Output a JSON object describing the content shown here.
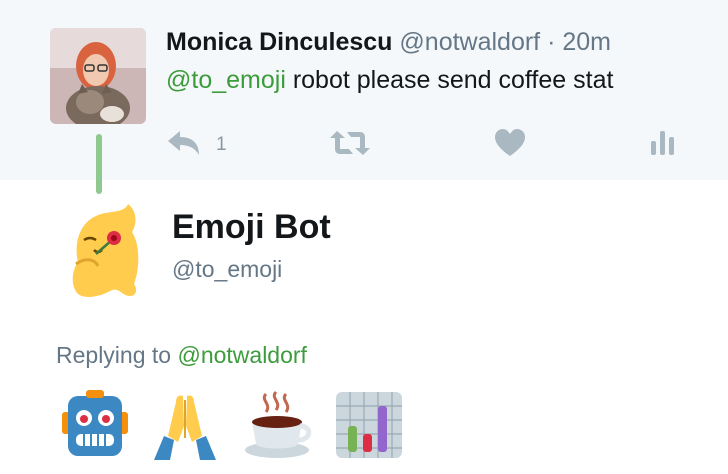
{
  "top_tweet": {
    "author_name": "Monica Dinculescu",
    "author_handle": "@notwaldorf",
    "separator": "·",
    "timestamp": "20m",
    "mention": "@to_emoji",
    "text": " robot please send coffee stat",
    "reply_count": "1"
  },
  "reply": {
    "author_name": "Emoji Bot",
    "author_handle": "@to_emoji",
    "replying_label": "Replying to ",
    "replying_to": "@notwaldorf",
    "emojis": [
      "robot-face",
      "folded-hands",
      "hot-beverage",
      "bar-chart"
    ]
  },
  "colors": {
    "mention": "#3c9c3c",
    "muted": "#657786",
    "icon": "#aab8c2",
    "thread_line": "#8fc98f",
    "top_bg": "#f5f8fa"
  }
}
